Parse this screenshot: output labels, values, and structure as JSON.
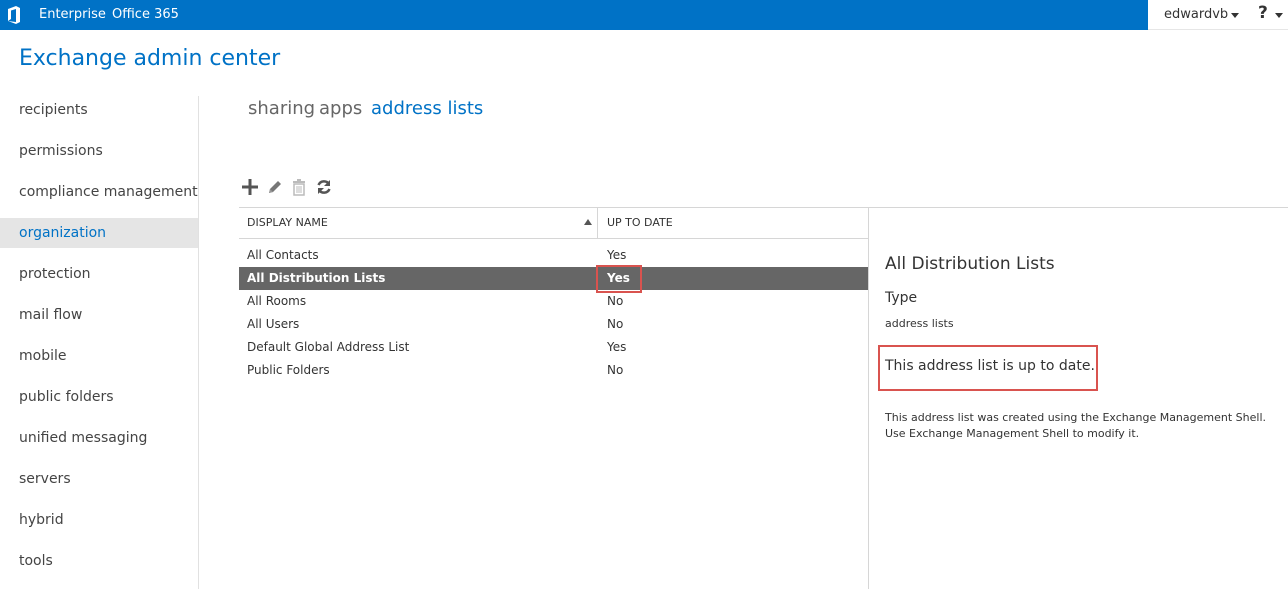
{
  "topbar": {
    "links": [
      "Enterprise",
      "Office 365"
    ],
    "user": "edwardvb",
    "help": "?",
    "accent": "#0072c6"
  },
  "app": {
    "title": "Exchange admin center"
  },
  "nav": {
    "items": [
      "recipients",
      "permissions",
      "compliance management",
      "organization",
      "protection",
      "mail flow",
      "mobile",
      "public folders",
      "unified messaging",
      "servers",
      "hybrid",
      "tools"
    ],
    "selected": "organization"
  },
  "tabs": {
    "items": [
      "sharing",
      "apps",
      "address lists"
    ],
    "active": "address lists"
  },
  "toolbar": {
    "icons": [
      "add-icon",
      "edit-icon",
      "delete-icon",
      "refresh-icon"
    ]
  },
  "list": {
    "columns": [
      "DISPLAY NAME",
      "UP TO DATE"
    ],
    "rows": [
      {
        "name": "All Contacts",
        "up_to_date": "Yes"
      },
      {
        "name": "All Distribution Lists",
        "up_to_date": "Yes"
      },
      {
        "name": "All Rooms",
        "up_to_date": "No"
      },
      {
        "name": "All Users",
        "up_to_date": "No"
      },
      {
        "name": "Default Global Address List",
        "up_to_date": "Yes"
      },
      {
        "name": "Public Folders",
        "up_to_date": "No"
      }
    ],
    "selected_row": "All Distribution Lists"
  },
  "details": {
    "title": "All Distribution Lists",
    "type_label": "Type",
    "type_value": "address lists",
    "status": "This address list is up to date.",
    "note": "This address list was created using the Exchange Management Shell. Use Exchange Management Shell to modify it."
  },
  "colors": {
    "highlight_box": "#d9534f",
    "selected_row": "#666666"
  }
}
